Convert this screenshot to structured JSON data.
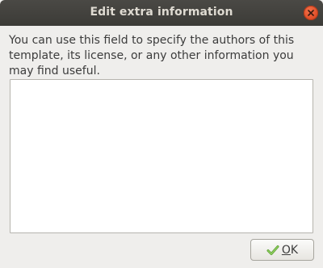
{
  "dialog": {
    "title": "Edit extra information",
    "description": "You can use this field to specify the authors of this template, its license, or any other information you may find useful.",
    "text_value": "",
    "ok_button": {
      "mnemonic": "O",
      "rest": "K",
      "icon": "checkmark-icon"
    },
    "close_icon": "close-icon"
  },
  "colors": {
    "titlebar": "#3c3b37",
    "close_button": "#e0502a",
    "background": "#efeeec",
    "checkmark": "#73b84a"
  }
}
